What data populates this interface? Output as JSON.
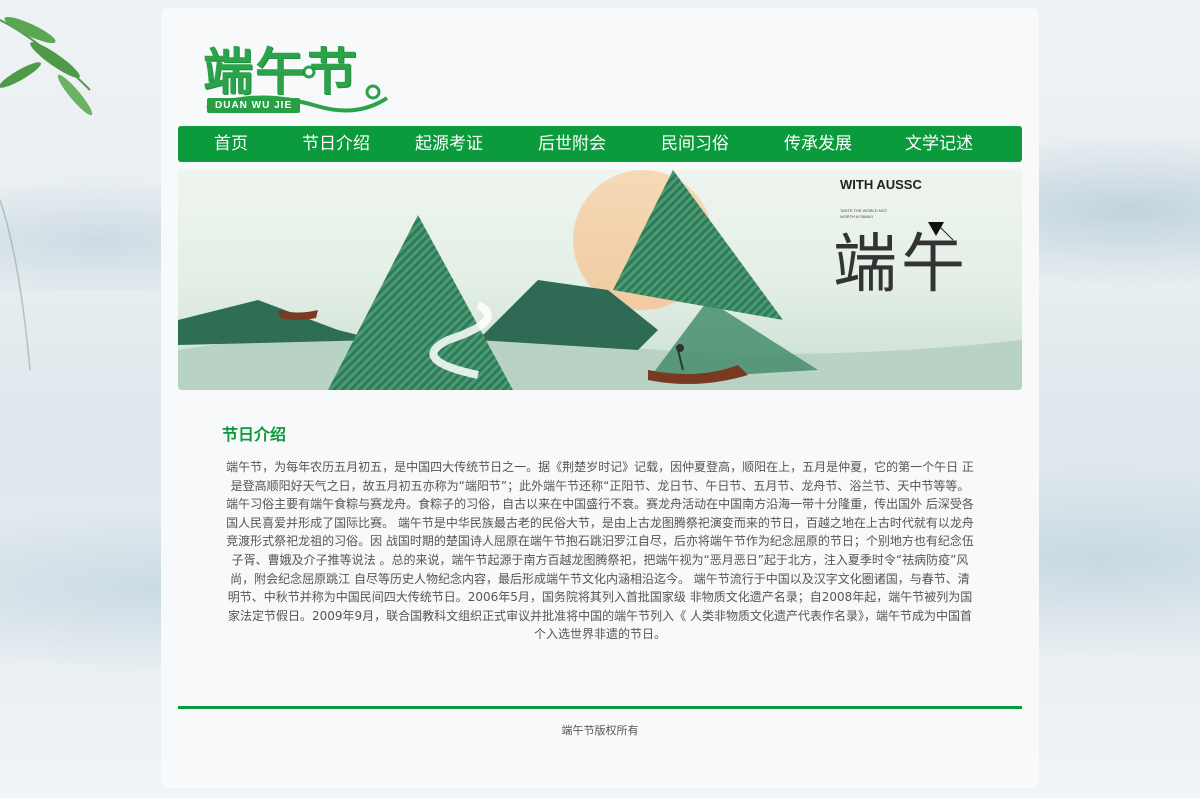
{
  "logo": {
    "title": "端午节",
    "subtitle": "DUAN WU JIE"
  },
  "nav": {
    "items": [
      {
        "label": "首页"
      },
      {
        "label": "节日介绍"
      },
      {
        "label": "起源考证"
      },
      {
        "label": "后世附会"
      },
      {
        "label": "民间习俗"
      },
      {
        "label": "传承发展"
      },
      {
        "label": "文学记述"
      }
    ]
  },
  "banner": {
    "heading": "WITH AUSSC",
    "small_text": "TASTE THE WORLD NOT WORTH A FAMILY",
    "title": "端午"
  },
  "section": {
    "title": "节日介绍",
    "body": "端午节，为每年农历五月初五，是中国四大传统节日之一。据《荆楚岁时记》记载，因仲夏登高，顺阳在上，五月是仲夏，它的第一个午日 正是登高顺阳好天气之日，故五月初五亦称为“端阳节”；此外端午节还称“正阳节、龙日节、午日节、五月节、龙舟节、浴兰节、天中节等等。端午习俗主要有端午食粽与赛龙舟。食粽子的习俗，自古以来在中国盛行不衰。赛龙舟活动在中国南方沿海一带十分隆重，传出国外 后深受各国人民喜爱并形成了国际比赛。 端午节是中华民族最古老的民俗大节，是由上古龙图腾祭祀演变而来的节日，百越之地在上古时代就有以龙舟竞渡形式祭祀龙祖的习俗。因 战国时期的楚国诗人屈原在端午节抱石跳汨罗江自尽，后亦将端午节作为纪念屈原的节日；个别地方也有纪念伍子胥、曹娥及介子推等说法 。总的来说，端午节起源于南方百越龙图腾祭祀，把端午视为“恶月恶日”起于北方，注入夏季时令“祛病防疫”风尚，附会纪念屈原跳江 自尽等历史人物纪念内容，最后形成端午节文化内涵相沿迄今。 端午节流行于中国以及汉字文化圈诸国，与春节、清明节、中秋节并称为中国民间四大传统节日。2006年5月，国务院将其列入首批国家级 非物质文化遗产名录；自2008年起，端午节被列为国家法定节假日。2009年9月，联合国教科文组织正式审议并批准将中国的端午节列入《 人类非物质文化遗产代表作名录》，端午节成为中国首个入选世界非遗的节日。"
  },
  "footer": {
    "text": "端午节版权所有"
  },
  "colors": {
    "brand_green": "#0b9a3c",
    "text_gray": "#555555"
  }
}
